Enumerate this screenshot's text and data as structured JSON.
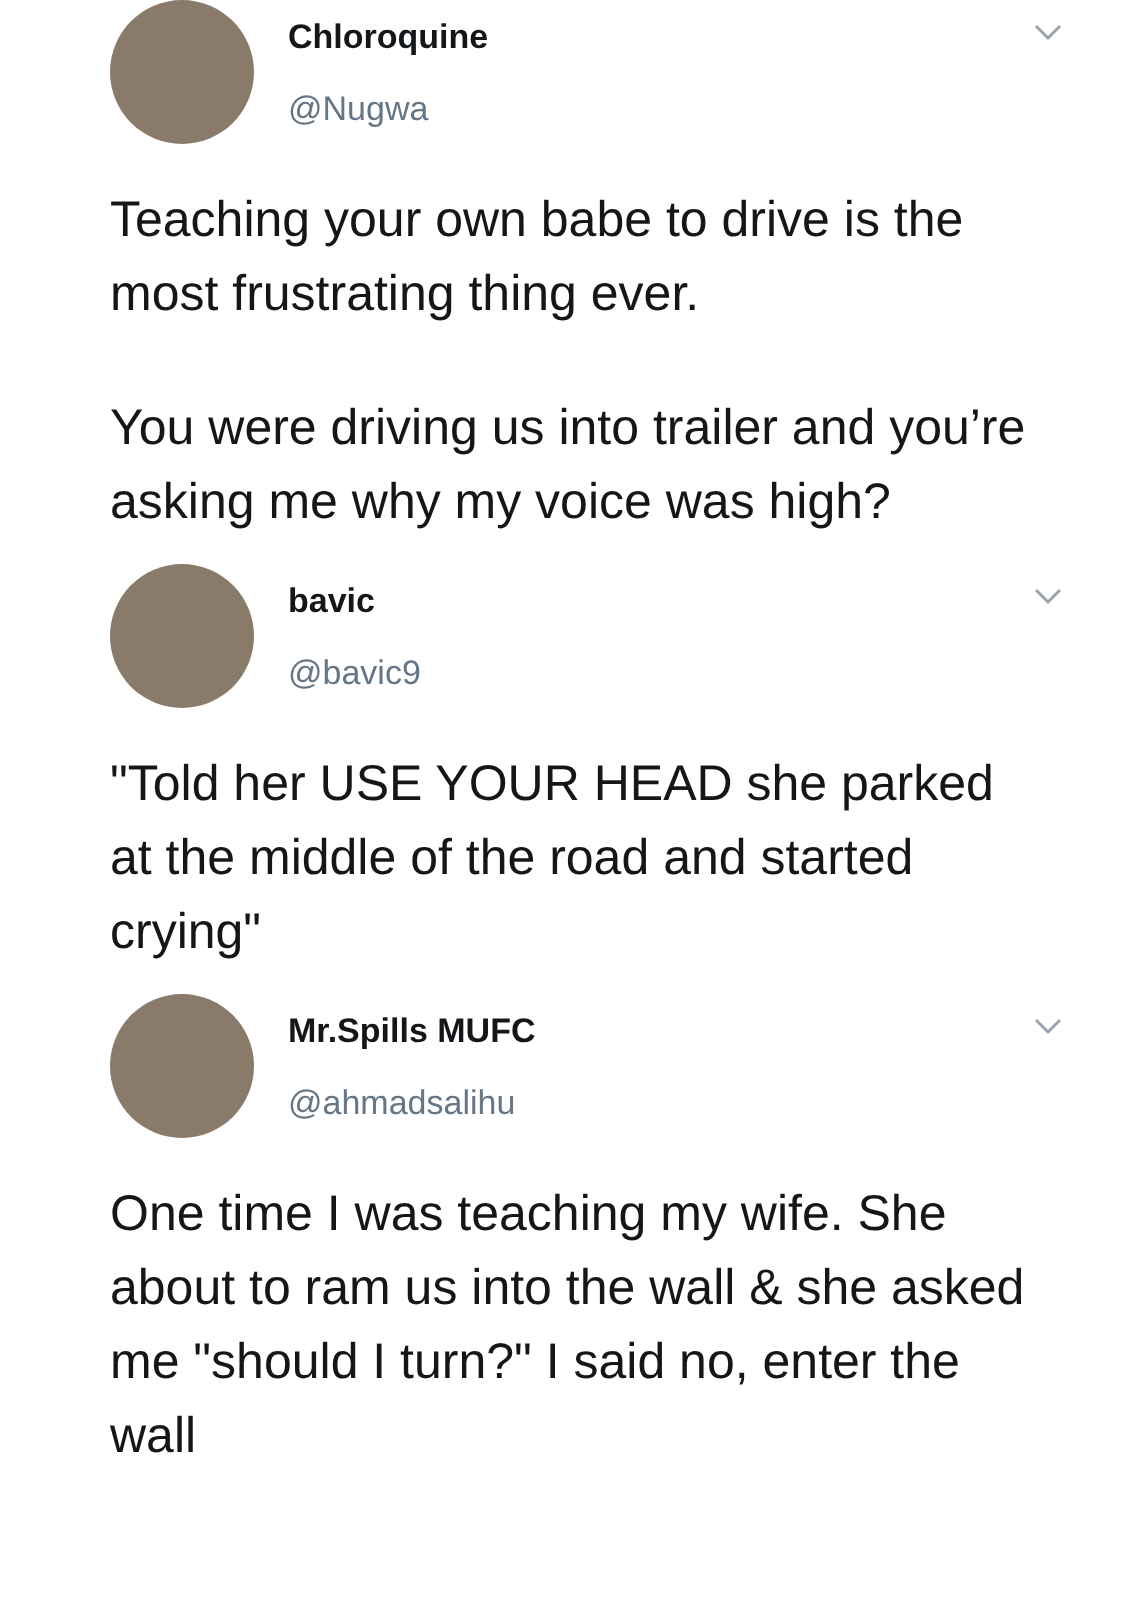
{
  "tweets": [
    {
      "name": "Chloroquine",
      "handle": "@Nugwa",
      "paragraphs": [
        "Teaching your own babe to drive is the most frustrating thing ever.",
        "You were driving us into trailer and you’re asking me why my voice was high?"
      ]
    },
    {
      "name": "bavic",
      "handle": "@bavic9",
      "paragraphs": [
        "\"Told her USE YOUR HEAD she parked at the middle of the road and started crying\""
      ]
    },
    {
      "name": "Mr.Spills MUFC",
      "handle": "@ahmadsalihu",
      "paragraphs": [
        "One time I was teaching my wife. She about to ram us into the wall & she asked me \"should I turn?\" I said no, enter the wall"
      ]
    }
  ]
}
